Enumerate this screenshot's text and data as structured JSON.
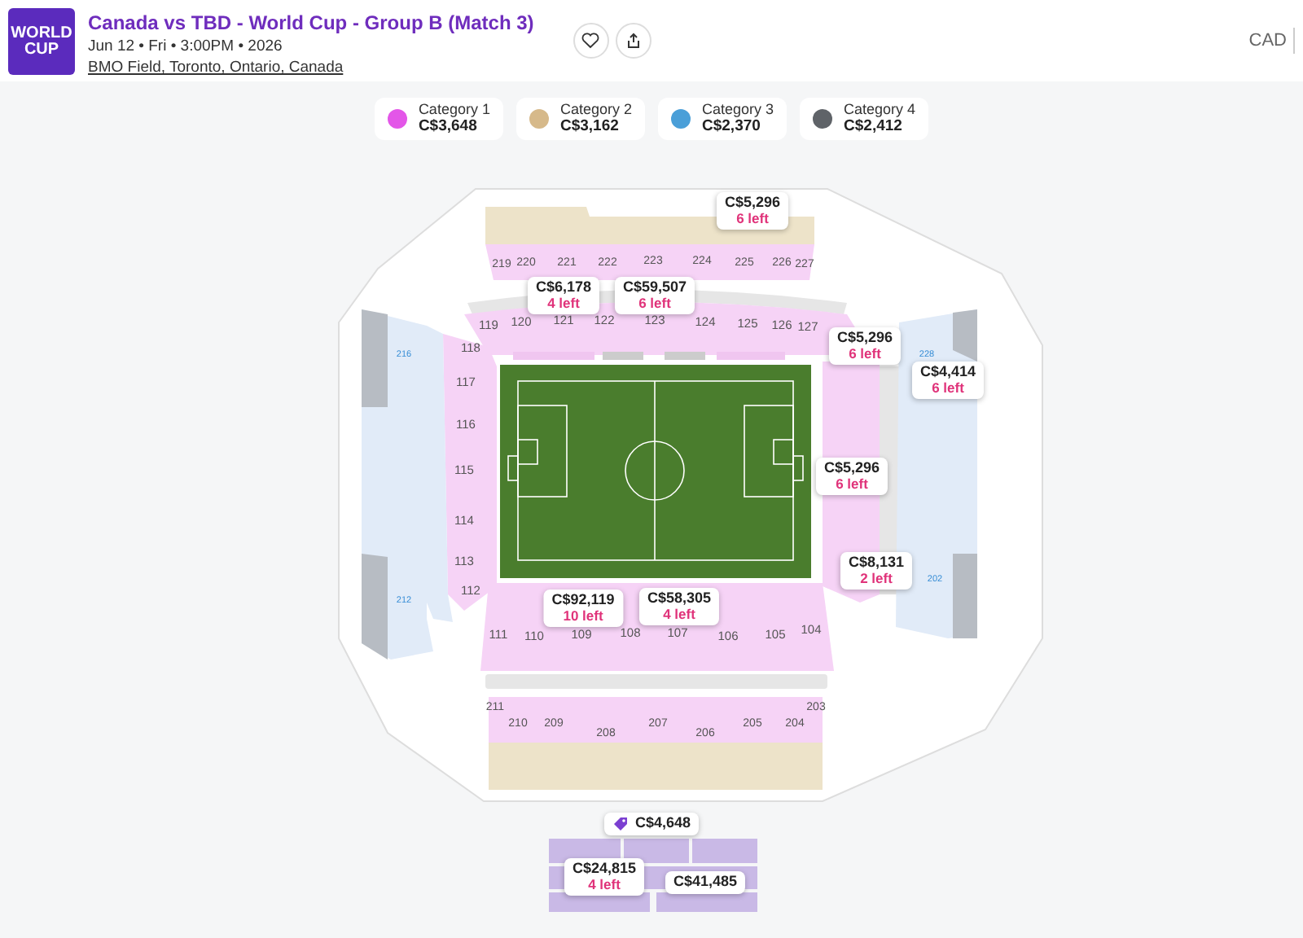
{
  "event": {
    "logo_lines": [
      "WORLD",
      "CUP"
    ],
    "title": "Canada vs TBD - World Cup - Group B (Match 3)",
    "date": "Jun 12 • Fri • 3:00PM • 2026",
    "venue": "BMO Field, Toronto, Ontario, Canada",
    "favorite": false,
    "currency": "CAD"
  },
  "categories": [
    {
      "name": "Category 1",
      "price": "C$3,648",
      "color": "#e356e8"
    },
    {
      "name": "Category 2",
      "price": "C$3,162",
      "color": "#d6b98a"
    },
    {
      "name": "Category 3",
      "price": "C$2,370",
      "color": "#4a9fd8"
    },
    {
      "name": "Category 4",
      "price": "C$2,412",
      "color": "#5f6368"
    }
  ],
  "sections": [
    "219",
    "220",
    "221",
    "222",
    "223",
    "224",
    "225",
    "226",
    "227",
    "119",
    "120",
    "121",
    "122",
    "123",
    "124",
    "125",
    "126",
    "127",
    "118",
    "117",
    "116",
    "115",
    "114",
    "113",
    "112",
    "111",
    "110",
    "109",
    "108",
    "107",
    "106",
    "105",
    "104",
    "211",
    "210",
    "209",
    "208",
    "207",
    "206",
    "205",
    "204",
    "203",
    "216",
    "212",
    "228",
    "202"
  ],
  "pins": [
    {
      "kind": "pin",
      "price": "C$5,296",
      "left": "6 left"
    },
    {
      "kind": "pin",
      "price": "C$6,178",
      "left": "4 left"
    },
    {
      "kind": "pin",
      "price": "C$59,507",
      "left": "6 left"
    },
    {
      "kind": "pin",
      "price": "C$5,296",
      "left": "6 left"
    },
    {
      "kind": "pin",
      "price": "C$4,414",
      "left": "6 left"
    },
    {
      "kind": "pin",
      "price": "C$5,296",
      "left": "6 left"
    },
    {
      "kind": "pin",
      "price": "C$8,131",
      "left": "2 left"
    },
    {
      "kind": "pin",
      "price": "C$92,119",
      "left": "10 left"
    },
    {
      "kind": "pin",
      "price": "C$58,305",
      "left": "4 left"
    },
    {
      "kind": "tag",
      "price": "C$4,648"
    },
    {
      "kind": "pin",
      "price": "C$24,815",
      "left": "4 left"
    },
    {
      "kind": "pin",
      "price": "C$41,485"
    }
  ]
}
